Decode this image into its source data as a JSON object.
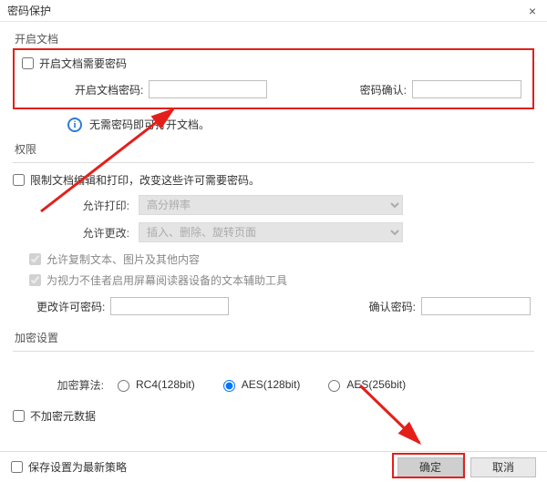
{
  "title": "密码保护",
  "close_glyph": "×",
  "group_open": {
    "label": "开启文档",
    "checkbox_label": "开启文档需要密码",
    "pw_label": "开启文档密码:",
    "pw_confirm_label": "密码确认:"
  },
  "info_text": "无需密码即可打开文档。",
  "group_perm": {
    "label": "权限",
    "restrict_label": "限制文档编辑和打印，改变这些许可需要密码。",
    "print_label": "允许打印:",
    "print_value": "高分辨率",
    "change_label": "允许更改:",
    "change_value": "插入、删除、旋转页面",
    "copy_label": "允许复制文本、图片及其他内容",
    "screenreader_label": "为视力不佳者启用屏幕阅读器设备的文本辅助工具",
    "change_pw_label": "更改许可密码:",
    "confirm_pw_label": "确认密码:"
  },
  "group_enc": {
    "label": "加密设置",
    "algorithm_label": "加密算法:",
    "opts": {
      "rc4": "RC4(128bit)",
      "aes128": "AES(128bit)",
      "aes256": "AES(256bit)"
    },
    "selected": "aes128",
    "nometa_label": "不加密元数据"
  },
  "footer": {
    "save_policy_label": "保存设置为最新策略",
    "ok": "确定",
    "cancel": "取消"
  }
}
